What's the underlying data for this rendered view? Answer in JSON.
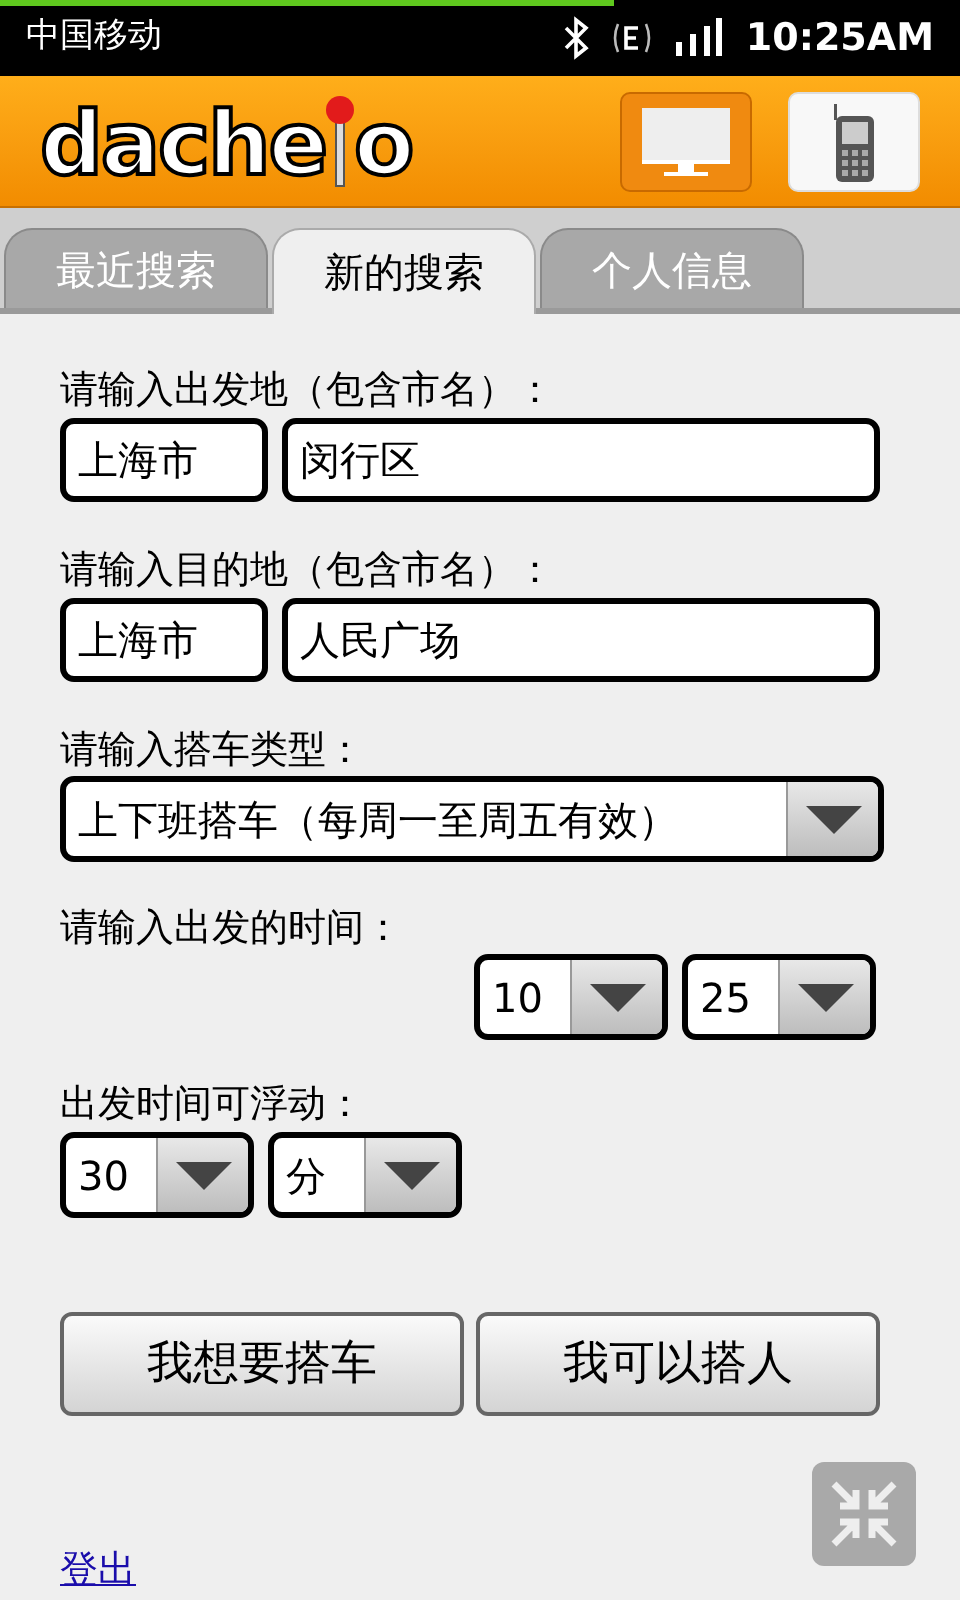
{
  "status_bar": {
    "carrier": "中国移动",
    "time": "10:25AM"
  },
  "header": {
    "logo_left": "dache",
    "logo_right": "o",
    "view_buttons": [
      {
        "kind": "desktop",
        "selected": false
      },
      {
        "kind": "phone",
        "selected": true
      }
    ]
  },
  "tabs": [
    {
      "label": "最近搜索",
      "selected": false
    },
    {
      "label": "新的搜索",
      "selected": true
    },
    {
      "label": "个人信息",
      "selected": false
    }
  ],
  "form": {
    "departure_label": "请输入出发地（包含市名）：",
    "departure_city": "上海市",
    "departure_district": "闵行区",
    "destination_label": "请输入目的地（包含市名）：",
    "destination_city": "上海市",
    "destination_place": "人民广场",
    "ride_type_label": "请输入搭车类型：",
    "ride_type": "上下班搭车（每周一至周五有效）",
    "time_label": "请输入出发的时间：",
    "hour": "10",
    "minute": "25",
    "flex_label": "出发时间可浮动：",
    "flex_amount": "30",
    "flex_unit": "分"
  },
  "buttons": [
    "我想要搭车",
    "我可以搭人"
  ],
  "logout": "登出"
}
